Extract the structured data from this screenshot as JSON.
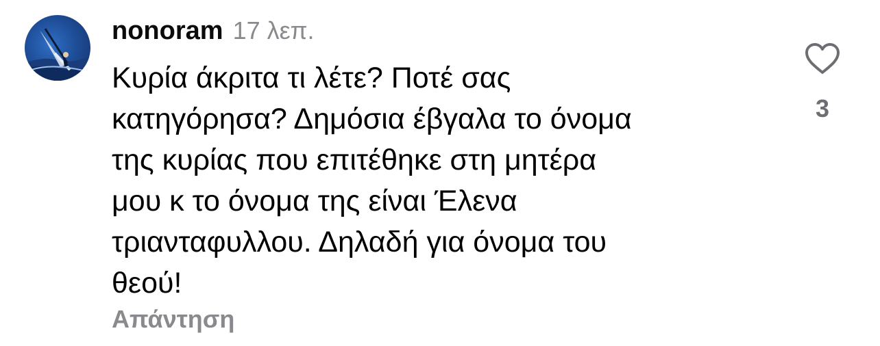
{
  "comment": {
    "username": "nonoram",
    "time": "17 λεπ.",
    "text_lines": [
      "Κυρία άκριτα τι λέτε? Ποτέ σας",
      "κατηγόρησα? Δημόσια έβγαλα το όνομα",
      "της κυρίας που επιτέθηκε στη μητέρα",
      "μου κ το όνομα της είναι Έλενα",
      "τριανταφυλλου. Δηλαδή για όνομα του",
      "θεού!"
    ],
    "reply_label": "Απάντηση",
    "like_count": "3",
    "like_icon": "heart-outline-icon",
    "avatar": "avatar-image"
  },
  "colors": {
    "text": "#000000",
    "secondary": "#8a8a8e",
    "icon": "#6d6d72"
  }
}
